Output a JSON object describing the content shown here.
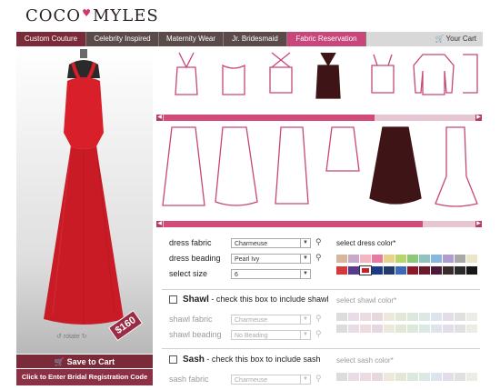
{
  "brand": {
    "logo_left": "COCO",
    "logo_right": "MYLES"
  },
  "nav": {
    "tabs": [
      {
        "label": "Custom Couture"
      },
      {
        "label": "Celebrity Inspired"
      },
      {
        "label": "Maternity Wear"
      },
      {
        "label": "Jr. Bridesmaid"
      },
      {
        "label": "Fabric Reservation"
      }
    ],
    "cart_label": "Your Cart"
  },
  "product": {
    "price": "$160",
    "rotate_label": "rotate",
    "dress_color": "#d81f2a"
  },
  "actions": {
    "save_label": "Save to Cart",
    "registration_label": "Click to Enter Bridal Registration Code"
  },
  "dress_options": {
    "fabric_label": "dress fabric",
    "fabric_value": "Charmeuse",
    "beading_label": "dress beading",
    "beading_value": "Pearl Ivy",
    "size_label": "select size",
    "size_value": "6",
    "color_label": "select dress color*"
  },
  "shawl": {
    "title": "Shawl",
    "instruction": " - check this box to include shawl",
    "color_label": "select shawl color*",
    "fabric_label": "shawl fabric",
    "fabric_value": "Charmeuse",
    "beading_label": "shawl beading",
    "beading_value": "No Beading"
  },
  "sash": {
    "title": "Sash",
    "instruction": " - check this box to include sash",
    "color_label": "select sash color*",
    "fabric_label": "sash fabric",
    "fabric_value": "Charmeuse"
  },
  "swatches_row1": [
    "#d6b79e",
    "#c9a9c9",
    "#f3b6c2",
    "#e87aa0",
    "#e6d28a",
    "#b6d66a",
    "#8cc878",
    "#8ec4c0",
    "#88b6dc",
    "#b09cd0",
    "#a8a8a8",
    "#eae4c8"
  ],
  "swatches_row2": [
    "#d43a3a",
    "#5a3a8a",
    "#c81e2a",
    "#1c3a8a",
    "#223a6a",
    "#3a6ab8",
    "#8a1a2a",
    "#6a1a2a",
    "#4a1a3a",
    "#3a2a2a",
    "#2a2a2a",
    "#161616"
  ],
  "swatches_dim": [
    "#dcdcdc",
    "#e8dde6",
    "#eedbe0",
    "#e6d8de",
    "#ece8dc",
    "#e2e8d6",
    "#dde8dc",
    "#dce8e6",
    "#dde4ec",
    "#e2dde8",
    "#e0e0e0",
    "#ecebe4"
  ]
}
